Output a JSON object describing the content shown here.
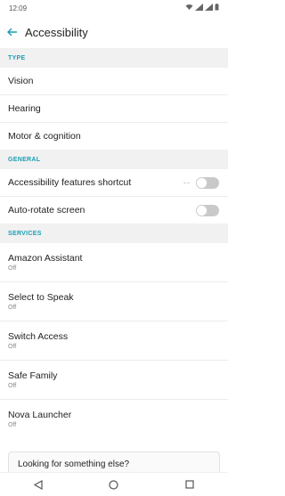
{
  "status_bar": {
    "time": "12:09"
  },
  "app_bar": {
    "title": "Accessibility"
  },
  "sections": {
    "type": {
      "header": "TYPE",
      "items": [
        "Vision",
        "Hearing",
        "Motor & cognition"
      ]
    },
    "general": {
      "header": "GENERAL",
      "items": [
        {
          "label": "Accessibility features shortcut",
          "toggle": false
        },
        {
          "label": "Auto-rotate screen",
          "toggle": false
        }
      ]
    },
    "services": {
      "header": "SERVICES",
      "items": [
        {
          "label": "Amazon Assistant",
          "status": "Off"
        },
        {
          "label": "Select to Speak",
          "status": "Off"
        },
        {
          "label": "Switch Access",
          "status": "Off"
        },
        {
          "label": "Safe Family",
          "status": "Off"
        },
        {
          "label": "Nova Launcher",
          "status": "Off"
        }
      ]
    }
  },
  "search_card": {
    "text": "Looking for something else?"
  },
  "icons": {
    "back": "arrow-left-icon",
    "nav": [
      "back-triangle-icon",
      "home-circle-icon",
      "recents-square-icon"
    ]
  },
  "colors": {
    "accent": "#1a9fb5",
    "section_bg": "#f1f1f1"
  }
}
